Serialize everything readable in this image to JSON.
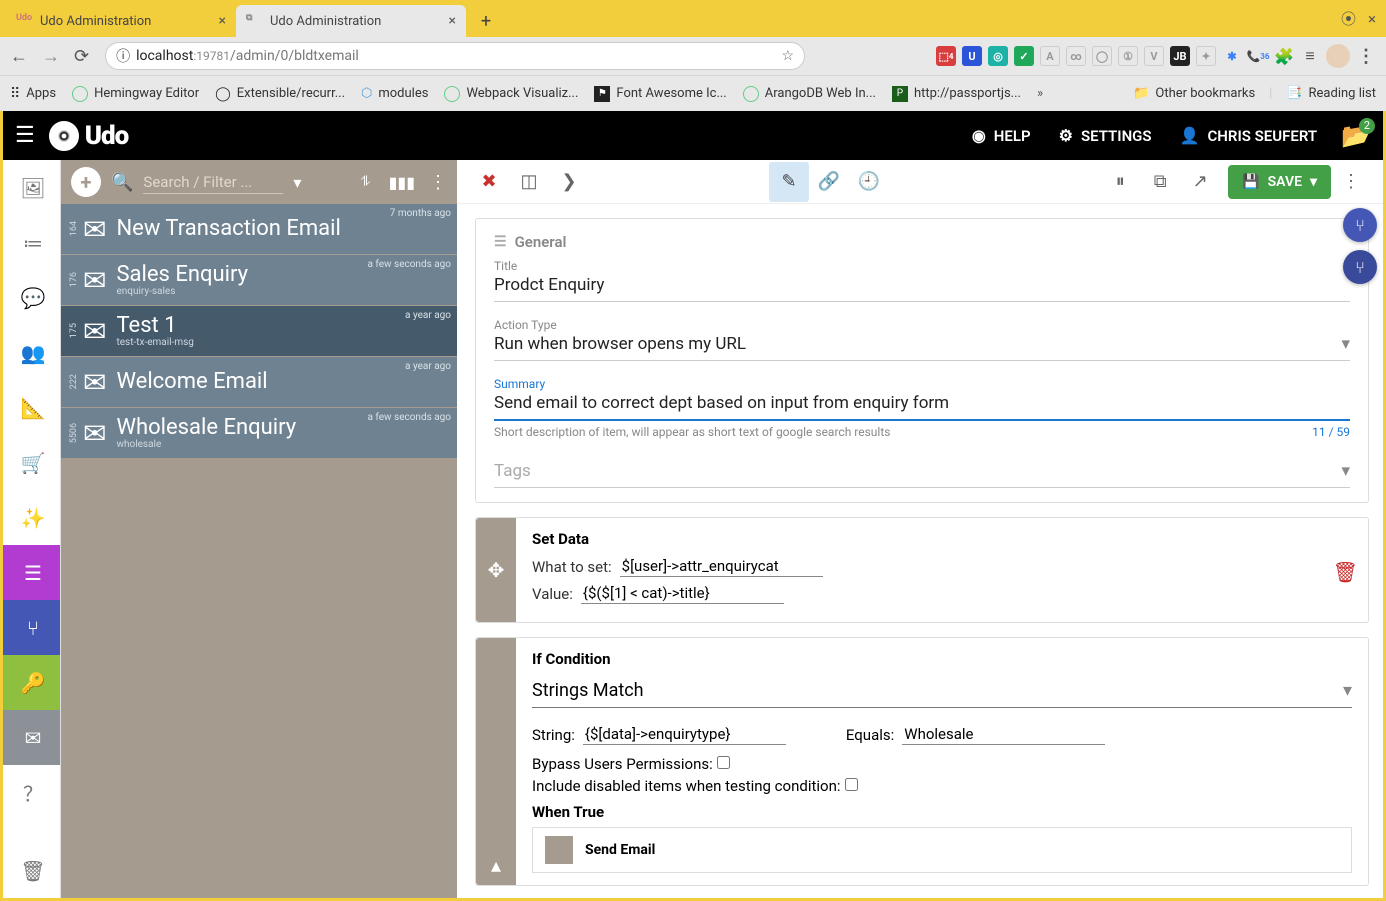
{
  "browser": {
    "tabs": [
      {
        "label": "Udo Administration",
        "fav": "Udo",
        "active": false
      },
      {
        "label": "Udo Administration",
        "fav": "⧉",
        "active": true
      }
    ],
    "url_host": "localhost",
    "url_port": ":19781",
    "url_path": "/admin/0/bldtxemail"
  },
  "bookmarks": {
    "items": [
      "Apps",
      "Hemingway Editor",
      "Extensible/recurr...",
      "modules",
      "Webpack Visualiz...",
      "Font Awesome Ic...",
      "ArangoDB Web In...",
      "http://passportjs..."
    ],
    "other": "Other bookmarks",
    "reading": "Reading list"
  },
  "header": {
    "brand": "Udo",
    "help": "HELP",
    "settings": "SETTINGS",
    "user": "CHRIS SEUFERT",
    "folder_badge": "2"
  },
  "list": {
    "search_placeholder": "Search / Filter ...",
    "items": [
      {
        "idx": "164",
        "title": "New Transaction Email",
        "sub": "",
        "time": "7 months ago",
        "selected": false
      },
      {
        "idx": "176",
        "title": "Sales Enquiry",
        "sub": "enquiry-sales",
        "time": "a few seconds ago",
        "selected": false
      },
      {
        "idx": "175",
        "title": "Test 1",
        "sub": "test-tx-email-msg",
        "time": "a year ago",
        "selected": true
      },
      {
        "idx": "222",
        "title": "Welcome Email",
        "sub": "",
        "time": "a year ago",
        "selected": false
      },
      {
        "idx": "5506",
        "title": "Wholesale Enquiry",
        "sub": "wholesale",
        "time": "a few seconds ago",
        "selected": false
      }
    ]
  },
  "detail": {
    "save": "SAVE",
    "general_section": "General",
    "title_label": "Title",
    "title_value": "Prodct Enquiry",
    "action_type_label": "Action Type",
    "action_type_value": "Run when browser opens my URL",
    "summary_label": "Summary",
    "summary_value": "Send email to correct dept based on input from enquiry form",
    "summary_helper": "Short description of item, will appear as short text of google search results",
    "summary_count_cur": "11",
    "summary_count_sep": "/",
    "summary_count_max": "59",
    "tags_placeholder": "Tags",
    "setdata": {
      "title": "Set Data",
      "what_label": "What to set:",
      "what_value": "$[user]->attr_enquirycat",
      "value_label": "Value:",
      "value_value": "{$($[1] < cat)->title}"
    },
    "cond": {
      "title": "If Condition",
      "match_type": "Strings Match",
      "string_label": "String:",
      "string_value": "{$[data]->enquirytype}",
      "equals_label": "Equals:",
      "equals_value": "Wholesale",
      "bypass_label": "Bypass Users Permissions:",
      "include_label": "Include disabled items when testing condition:",
      "when_true": "When True",
      "send_email": "Send Email"
    }
  }
}
